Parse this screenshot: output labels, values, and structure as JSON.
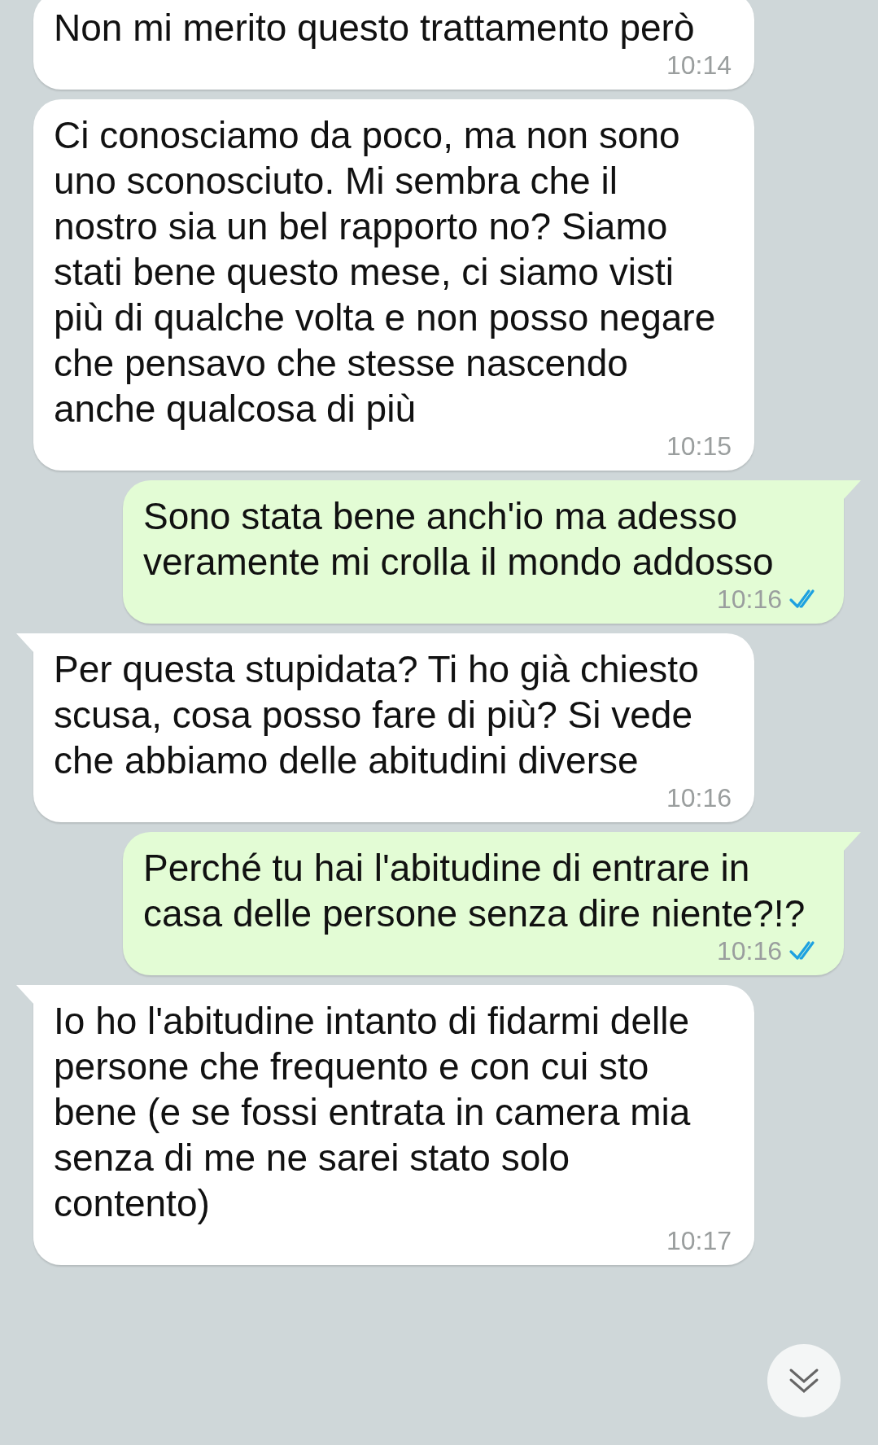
{
  "messages": [
    {
      "kind": "incoming",
      "tail": false,
      "text": "Non mi merito questo trattamento però",
      "time": "10:14"
    },
    {
      "kind": "incoming",
      "tail": false,
      "text": "Ci conosciamo da poco, ma non sono uno sconosciuto. Mi sembra che il nostro sia un bel rapporto no? Siamo stati bene questo mese, ci siamo visti più di qualche volta e non posso negare che pensavo che stesse nascendo anche qualcosa di più",
      "time": "10:15"
    },
    {
      "kind": "outgoing",
      "tail": true,
      "text": "Sono stata bene anch'io ma adesso veramente mi crolla il mondo addosso",
      "time": "10:16",
      "read": true
    },
    {
      "kind": "incoming",
      "tail": true,
      "text": "Per questa stupidata? Ti ho già chiesto scusa, cosa posso fare di più? Si vede che abbiamo delle abitudini diverse",
      "time": "10:16"
    },
    {
      "kind": "outgoing",
      "tail": true,
      "text": "Perché tu hai l'abitudine di entrare in casa delle persone senza dire niente?!?",
      "time": "10:16",
      "read": true
    },
    {
      "kind": "incoming",
      "tail": true,
      "text": "Io ho l'abitudine intanto di fidarmi delle persone che frequento e con cui sto bene (e se fossi entrata in camera mia senza di me ne sarei stato solo contento)",
      "time": "10:17"
    }
  ],
  "scroll_down_button": {
    "visible": true
  }
}
